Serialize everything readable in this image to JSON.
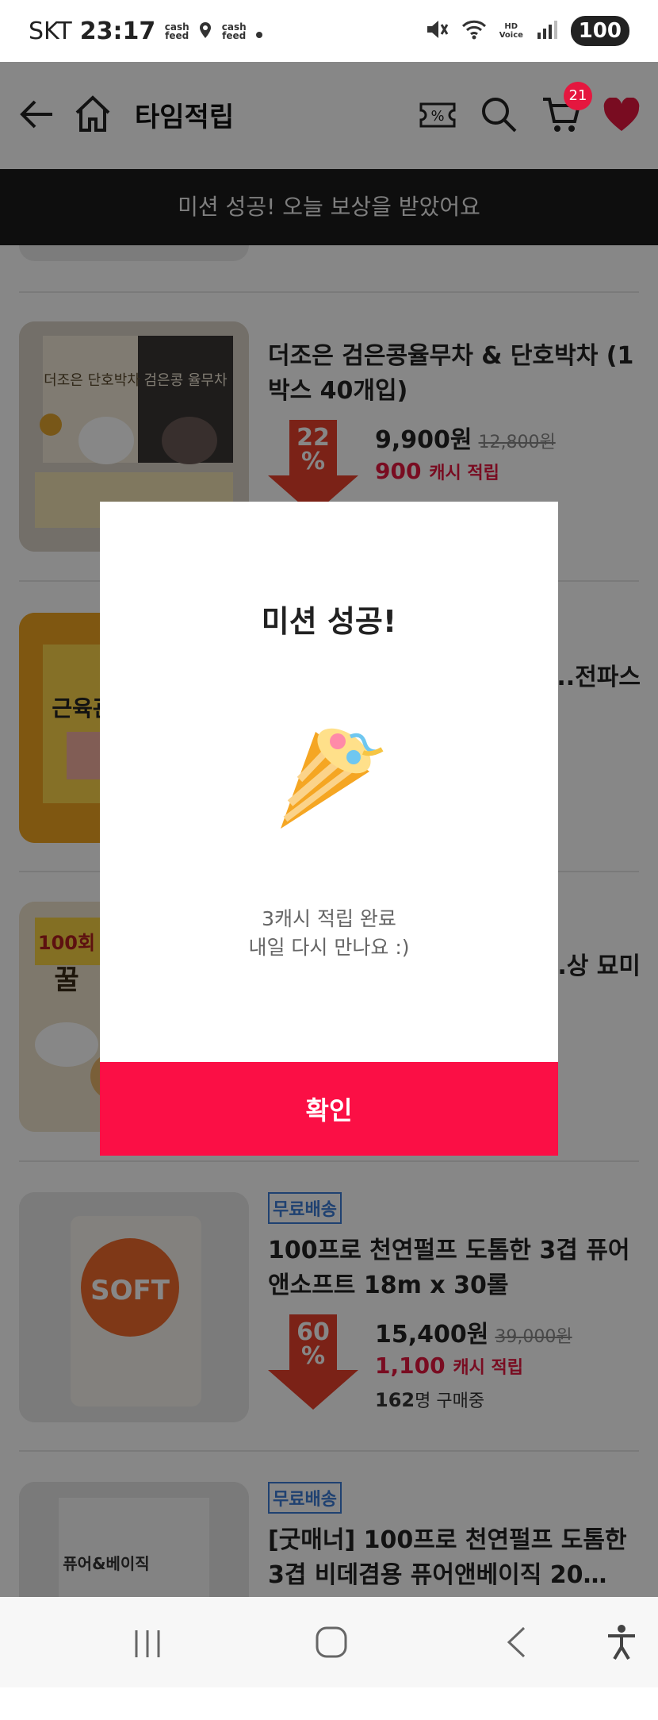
{
  "status": {
    "carrier": "SKT",
    "time": "23:17",
    "app_badge_1": "cash feed",
    "app_badge_2": "cash feed",
    "battery": "100",
    "hd_label": "HD Voice"
  },
  "header": {
    "title": "타임적립",
    "cart_count": "21"
  },
  "toast": {
    "text": "미션 성공! 오늘 보상을 받았어요"
  },
  "products": [
    {
      "name": "더조은 검은콩율무차 & 단호박차 (1박스 40개입)",
      "free_shipping": "",
      "discount": "22%",
      "price": "9,900원",
      "original_price": "12,800원",
      "cash_amount": "900",
      "cash_label": "캐시 적립",
      "buyers_count": "",
      "buyers_label": "",
      "thumb_text_1": "더조은 단호박차",
      "thumb_text_2": "검은콩 율무차"
    },
    {
      "name": "...전파스",
      "thumb_text_1": "근육관"
    },
    {
      "name": "...상 묘미",
      "thumb_text_1": "100회",
      "thumb_text_2": "꿀"
    },
    {
      "name": "100프로 천연펄프 도톰한 3겹 퓨어앤소프트 18m x 30롤",
      "free_shipping": "무료배송",
      "discount": "60%",
      "price": "15,400원",
      "original_price": "39,000원",
      "cash_amount": "1,100",
      "cash_label": "캐시 적립",
      "buyers_count": "162",
      "buyers_label": "명 구매중",
      "thumb_text_1": "SOFT"
    },
    {
      "name": "[굿매너] 100프로 천연펄프 도톰한 3겹 비데겸용 퓨어앤베이직 20…",
      "free_shipping": "무료배송",
      "thumb_text_1": "퓨어&베이직"
    }
  ],
  "modal": {
    "title": "미션 성공!",
    "message_line1": "3캐시 적립 완료",
    "message_line2": "내일 다시 만나요 :)",
    "confirm_label": "확인"
  },
  "colors": {
    "accent": "#fb0f45",
    "discount_arrow": "#e8412c",
    "free_shipping": "#3b7bd5",
    "toast_bg": "#1c1c1c"
  }
}
